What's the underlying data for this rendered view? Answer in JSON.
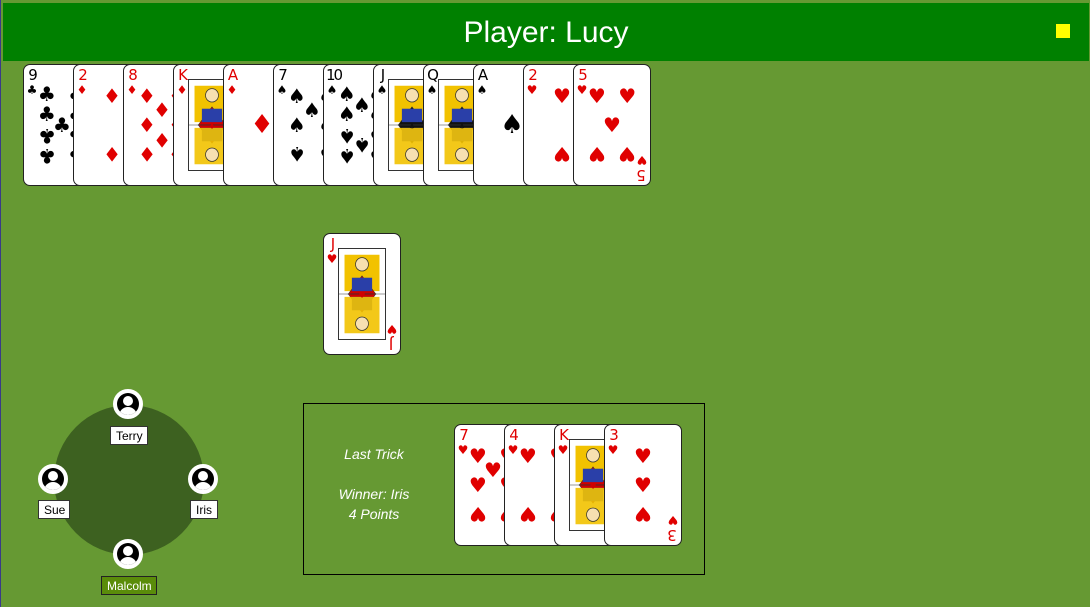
{
  "header": {
    "title": "Player: Lucy",
    "menu_color": "#ffff00"
  },
  "hand": [
    {
      "rank": "9",
      "suit": "clubs",
      "symbol": "♣",
      "color": "black"
    },
    {
      "rank": "2",
      "suit": "diamonds",
      "symbol": "♦",
      "color": "red"
    },
    {
      "rank": "8",
      "suit": "diamonds",
      "symbol": "♦",
      "color": "red"
    },
    {
      "rank": "K",
      "suit": "diamonds",
      "symbol": "♦",
      "color": "red"
    },
    {
      "rank": "A",
      "suit": "diamonds",
      "symbol": "♦",
      "color": "red"
    },
    {
      "rank": "7",
      "suit": "spades",
      "symbol": "♠",
      "color": "black"
    },
    {
      "rank": "10",
      "suit": "spades",
      "symbol": "♠",
      "color": "black"
    },
    {
      "rank": "J",
      "suit": "spades",
      "symbol": "♠",
      "color": "black"
    },
    {
      "rank": "Q",
      "suit": "spades",
      "symbol": "♠",
      "color": "black"
    },
    {
      "rank": "A",
      "suit": "spades",
      "symbol": "♠",
      "color": "black"
    },
    {
      "rank": "2",
      "suit": "hearts",
      "symbol": "♥",
      "color": "red"
    },
    {
      "rank": "5",
      "suit": "hearts",
      "symbol": "♥",
      "color": "red"
    }
  ],
  "played_card": {
    "rank": "J",
    "suit": "hearts",
    "symbol": "♥",
    "color": "red"
  },
  "last_trick": {
    "title": "Last Trick",
    "winner": "Winner: Iris",
    "points": "4 Points",
    "cards": [
      {
        "rank": "7",
        "suit": "hearts",
        "symbol": "♥",
        "color": "red"
      },
      {
        "rank": "4",
        "suit": "hearts",
        "symbol": "♥",
        "color": "red"
      },
      {
        "rank": "K",
        "suit": "hearts",
        "symbol": "♥",
        "color": "red"
      },
      {
        "rank": "3",
        "suit": "hearts",
        "symbol": "♥",
        "color": "red"
      }
    ]
  },
  "seats": {
    "top": "Terry",
    "left": "Sue",
    "right": "Iris",
    "bottom": "Malcolm"
  },
  "colors": {
    "felt": "#669933",
    "header": "#008000",
    "table": "#3d6120",
    "red_suit": "#e00000"
  }
}
